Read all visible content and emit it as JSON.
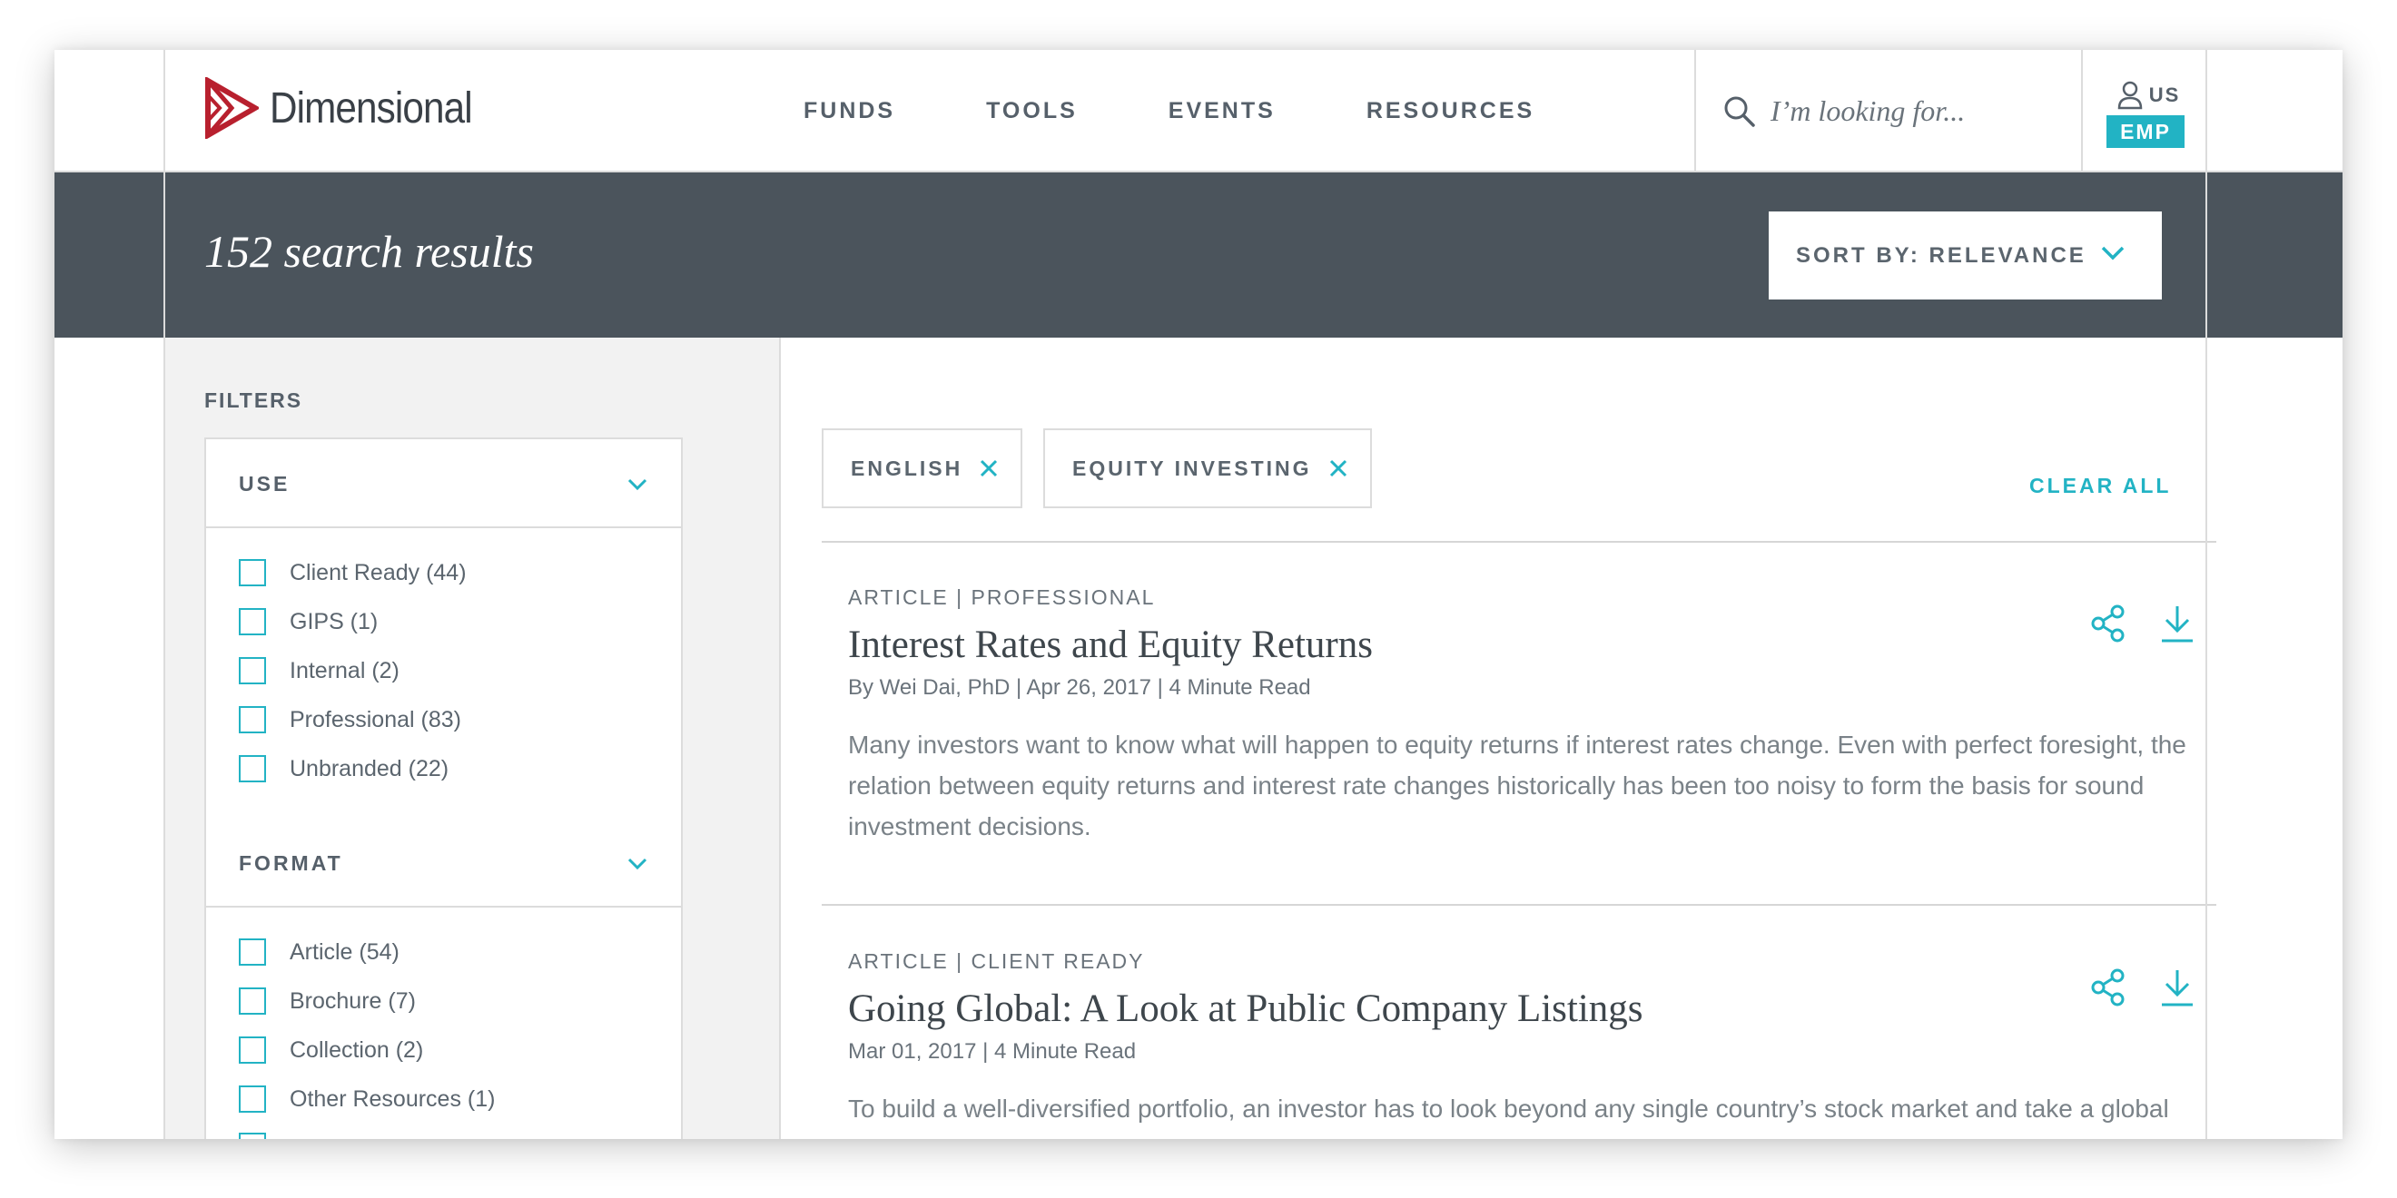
{
  "header": {
    "logo_text": "Dimensional",
    "nav": [
      "FUNDS",
      "TOOLS",
      "EVENTS",
      "RESOURCES"
    ],
    "search_placeholder": "I’m looking for...",
    "region": "US",
    "role_badge": "EMP"
  },
  "banner": {
    "results_title": "152 search results",
    "sort_label": "SORT BY: RELEVANCE"
  },
  "sidebar": {
    "heading": "FILTERS",
    "panels": [
      {
        "title": "USE",
        "options": [
          "Client Ready (44)",
          "GIPS (1)",
          "Internal (2)",
          "Professional (83)",
          "Unbranded (22)"
        ]
      },
      {
        "title": "FORMAT",
        "options": [
          "Article (54)",
          "Brochure (7)",
          "Collection (2)",
          "Other Resources (1)"
        ]
      }
    ]
  },
  "active_filters": {
    "chips": [
      "ENGLISH",
      "EQUITY INVESTING"
    ],
    "clear_all": "CLEAR ALL"
  },
  "results": [
    {
      "meta": "ARTICLE | PROFESSIONAL",
      "title": "Interest Rates and Equity Returns",
      "byline": "By Wei Dai, PhD  | Apr 26, 2017  | 4 Minute Read",
      "summary": "Many investors want to know what will happen to equity returns if interest rates change. Even with perfect foresight, the relation between equity returns and interest rate changes historically has been too noisy to form the basis for sound investment decisions."
    },
    {
      "meta": "ARTICLE | CLIENT READY",
      "title": "Going Global: A Look at Public Company Listings",
      "byline": "Mar 01, 2017  | 4 Minute Read",
      "summary": "To build a well-diversified portfolio, an investor has to look beyond any single country’s stock market and take a global approach."
    }
  ],
  "colors": {
    "accent": "#22b3c4",
    "banner": "#4b545c",
    "logo_red": "#b8202e",
    "sidebar_bg": "#f2f2f2"
  },
  "icons": {
    "logo": "triangle-play-logo-icon",
    "search": "search-icon",
    "user": "user-icon",
    "sort": "chevron-down-icon",
    "chip_remove": "close-icon",
    "share": "share-icon",
    "download": "download-icon"
  }
}
